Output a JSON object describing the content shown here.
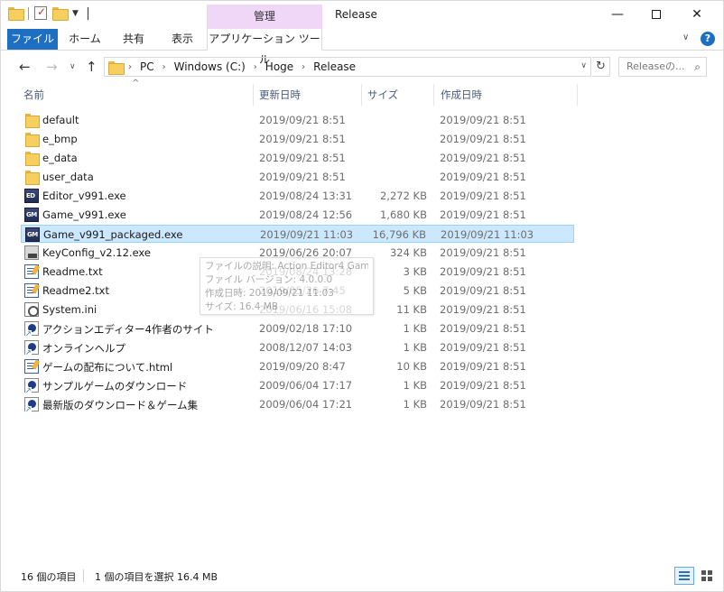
{
  "window": {
    "title": "Release",
    "context_tab": "管理",
    "minimize": "—",
    "close": "✕"
  },
  "ribbon": {
    "file": "ファイル",
    "home": "ホーム",
    "share": "共有",
    "view": "表示",
    "app_tools": "アプリケーション ツール",
    "expand": "∨",
    "help": "?"
  },
  "nav": {
    "back": "←",
    "forward": "→",
    "recent": "∨",
    "up": "↑",
    "crumbs": [
      "PC",
      "Windows (C:)",
      "Hoge",
      "Release"
    ],
    "crumb_sep": "›",
    "refresh": "↻",
    "search_placeholder": "Releaseの...",
    "search_icon": "⌕"
  },
  "columns": {
    "name": "名前",
    "modified": "更新日時",
    "size": "サイズ",
    "created": "作成日時",
    "sort_indicator": "^"
  },
  "files": [
    {
      "name": "default",
      "modified": "2019/09/21 8:51",
      "size": "",
      "created": "2019/09/21 8:51",
      "icon": "folder-icon",
      "selected": false
    },
    {
      "name": "e_bmp",
      "modified": "2019/09/21 8:51",
      "size": "",
      "created": "2019/09/21 8:51",
      "icon": "folder-icon",
      "selected": false
    },
    {
      "name": "e_data",
      "modified": "2019/09/21 8:51",
      "size": "",
      "created": "2019/09/21 8:51",
      "icon": "folder-icon",
      "selected": false
    },
    {
      "name": "user_data",
      "modified": "2019/09/21 8:51",
      "size": "",
      "created": "2019/09/21 8:51",
      "icon": "folder-icon",
      "selected": false
    },
    {
      "name": "Editor_v991.exe",
      "modified": "2019/08/24 13:31",
      "size": "2,272 KB",
      "created": "2019/09/21 8:51",
      "icon": "editor-exe-icon",
      "selected": false
    },
    {
      "name": "Game_v991.exe",
      "modified": "2019/08/24 12:56",
      "size": "1,680 KB",
      "created": "2019/09/21 8:51",
      "icon": "game-exe-icon",
      "selected": false
    },
    {
      "name": "Game_v991_packaged.exe",
      "modified": "2019/09/21 11:03",
      "size": "16,796 KB",
      "created": "2019/09/21 11:03",
      "icon": "game-exe-icon",
      "selected": true
    },
    {
      "name": "KeyConfig_v2.12.exe",
      "modified": "2019/06/26 20:07",
      "size": "324 KB",
      "created": "2019/09/21 8:51",
      "icon": "keyconfig-exe-icon",
      "selected": false
    },
    {
      "name": "Readme.txt",
      "modified": "2019/08/24 13:28",
      "size": "3 KB",
      "created": "2019/09/21 8:51",
      "icon": "text-file-icon",
      "selected": false
    },
    {
      "name": "Readme2.txt",
      "modified": "2019/05/26 7:45",
      "size": "5 KB",
      "created": "2019/09/21 8:51",
      "icon": "text-file-icon",
      "selected": false
    },
    {
      "name": "System.ini",
      "modified": "2019/06/16 15:08",
      "size": "11 KB",
      "created": "2019/09/21 8:51",
      "icon": "ini-file-icon",
      "selected": false
    },
    {
      "name": "アクションエディター4作者のサイト",
      "modified": "2009/02/18 17:10",
      "size": "1 KB",
      "created": "2019/09/21 8:51",
      "icon": "internet-shortcut-icon",
      "selected": false
    },
    {
      "name": "オンラインヘルプ",
      "modified": "2008/12/07 14:03",
      "size": "1 KB",
      "created": "2019/09/21 8:51",
      "icon": "internet-shortcut-icon",
      "selected": false
    },
    {
      "name": "ゲームの配布について.html",
      "modified": "2019/09/20 8:47",
      "size": "10 KB",
      "created": "2019/09/21 8:51",
      "icon": "html-file-icon",
      "selected": false
    },
    {
      "name": "サンプルゲームのダウンロード",
      "modified": "2009/06/04 17:17",
      "size": "1 KB",
      "created": "2019/09/21 8:51",
      "icon": "internet-shortcut-icon",
      "selected": false
    },
    {
      "name": "最新版のダウンロード＆ゲーム集",
      "modified": "2009/06/04 17:21",
      "size": "1 KB",
      "created": "2019/09/21 8:51",
      "icon": "internet-shortcut-icon",
      "selected": false
    }
  ],
  "tooltip": {
    "lines": [
      "ファイルの説明: Action Editor4 Game",
      "ファイル バージョン: 4.0.0.0",
      "作成日時: 2019/09/21 11:03",
      "サイズ: 16.4 MB"
    ]
  },
  "status": {
    "count": "16 個の項目",
    "selection": "1 個の項目を選択  16.4 MB"
  }
}
